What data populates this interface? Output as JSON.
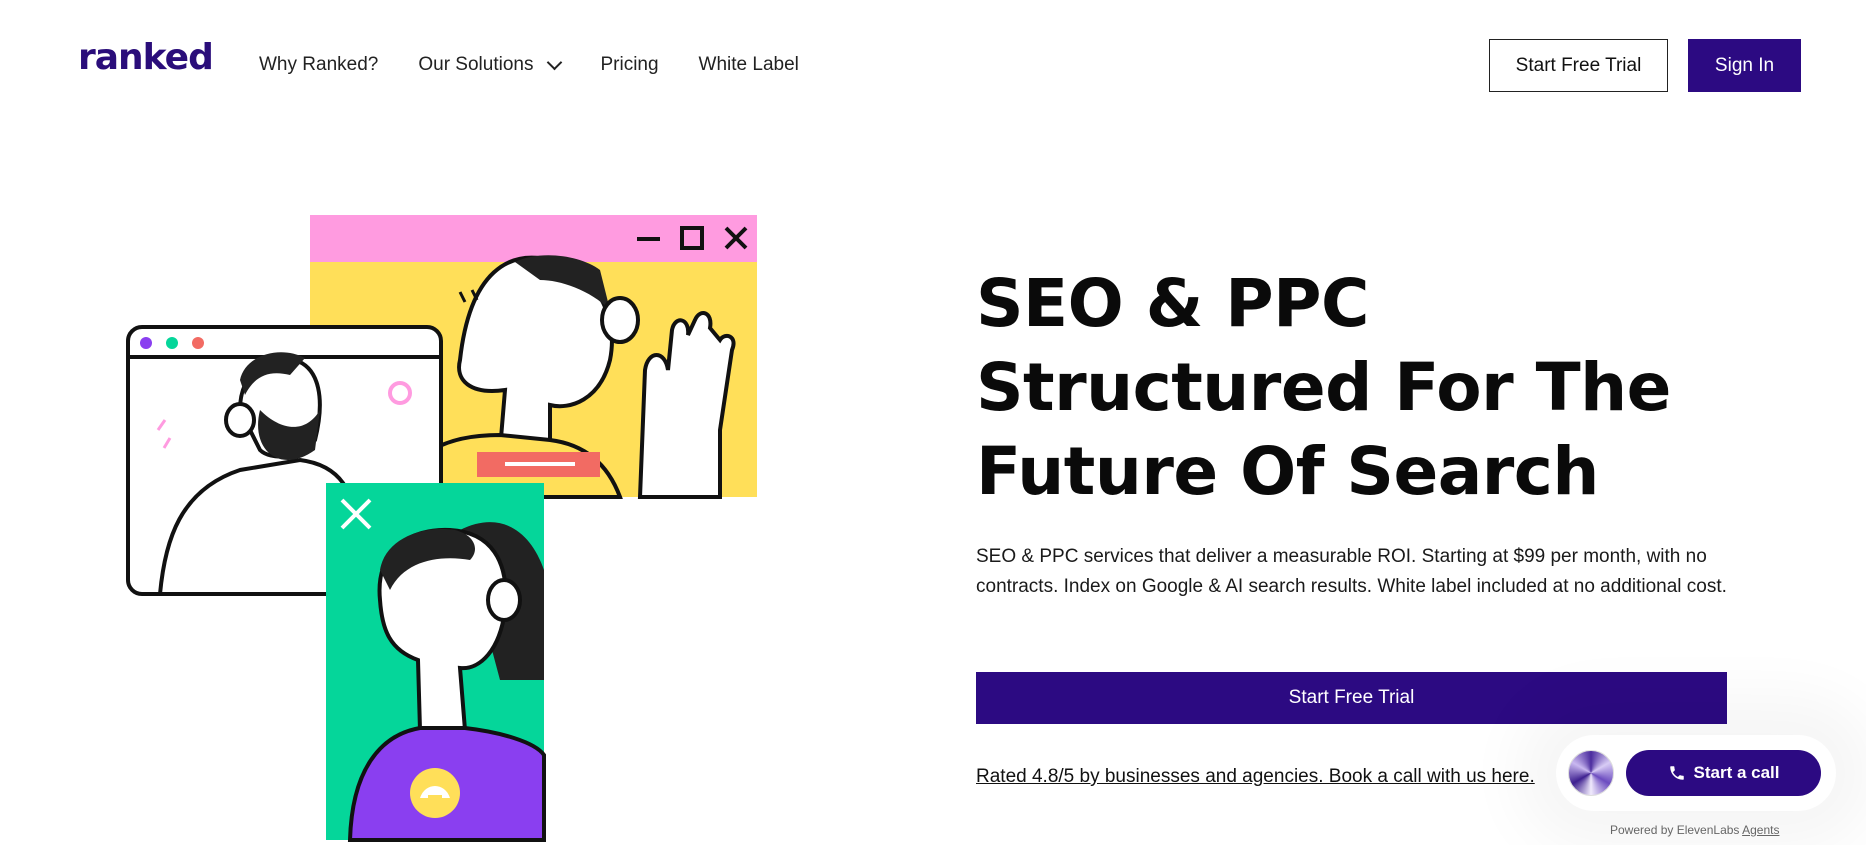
{
  "header": {
    "logo": "ranked",
    "nav": [
      {
        "label": "Why Ranked?"
      },
      {
        "label": "Our Solutions",
        "has_dropdown": true
      },
      {
        "label": "Pricing"
      },
      {
        "label": "White Label"
      }
    ],
    "trial_label": "Start Free Trial",
    "signin_label": "Sign In"
  },
  "hero": {
    "title": "SEO & PPC Structured For The Future Of Search",
    "subtitle": "SEO & PPC services that deliver a measurable ROI. Starting at $99 per month, with no contracts. Index on Google & AI search results. White label included at no additional cost.",
    "cta_label": "Start Free Trial",
    "rated_link": "Rated 4.8/5 by businesses and agencies. Book a call with us here."
  },
  "widget": {
    "call_label": "Start a call",
    "powered_prefix": "Powered by ElevenLabs",
    "powered_link": "Agents"
  },
  "colors": {
    "brand": "#2c0a82",
    "pink": "#ff9be0",
    "yellow": "#ffdf59",
    "green": "#05d69a",
    "purple": "#8a3ff0",
    "red": "#f26b63"
  }
}
